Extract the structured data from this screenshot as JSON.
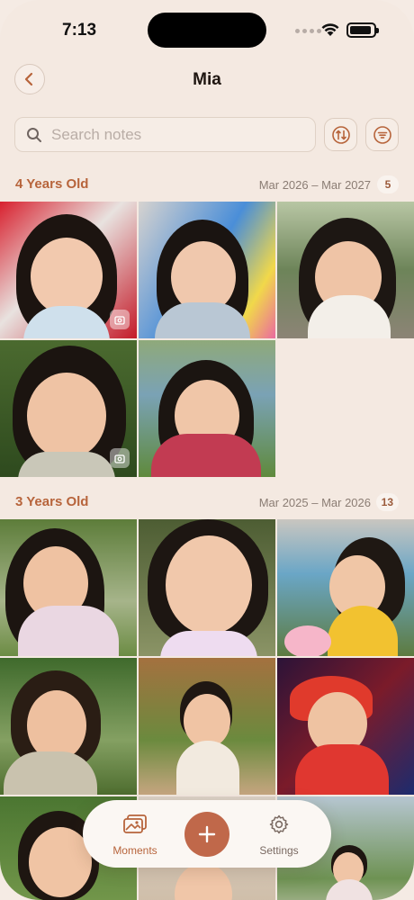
{
  "status": {
    "time": "7:13"
  },
  "nav": {
    "title": "Mia"
  },
  "search": {
    "placeholder": "Search notes"
  },
  "colors": {
    "accent": "#b7643b",
    "add_button": "#c0684a",
    "background": "#f4e9e1"
  },
  "sections": [
    {
      "title": "4 Years Old",
      "range": "Mar 2026 – Mar 2027",
      "count": "5"
    },
    {
      "title": "3 Years Old",
      "range": "Mar 2025 – Mar 2026",
      "count": "13"
    }
  ],
  "tabbar": {
    "moments_label": "Moments",
    "settings_label": "Settings"
  },
  "icons": [
    "chevron-left-icon",
    "search-icon",
    "sort-icon",
    "filter-icon",
    "photo-badge-icon",
    "moments-icon",
    "plus-icon",
    "gear-icon"
  ]
}
